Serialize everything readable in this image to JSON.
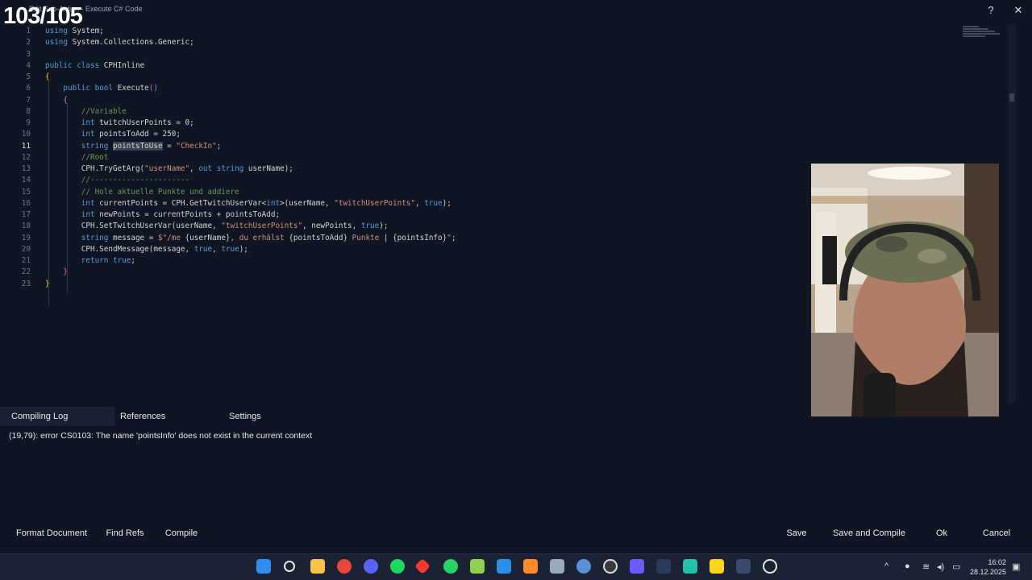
{
  "window": {
    "title": "Edit Sub-Action - Execute C# Code",
    "counter_overlay": "103/105",
    "help_label": "?",
    "close_label": "✕"
  },
  "editor": {
    "current_line": 11,
    "lines": [
      {
        "n": "1",
        "html": "<span class=\"kw\">using</span> System;"
      },
      {
        "n": "2",
        "html": "<span class=\"kw\">using</span> System.Collections.Generic;"
      },
      {
        "n": "3",
        "html": ""
      },
      {
        "n": "4",
        "html": "<span class=\"kw\">public</span> <span class=\"kw\">class</span> CPHInline"
      },
      {
        "n": "5",
        "html": "<span class=\"br1\">{</span>"
      },
      {
        "n": "6",
        "html": "    <span class=\"kw\">public</span> <span class=\"kw\">bool</span> Execute<span class=\"br2\">()</span>"
      },
      {
        "n": "7",
        "html": "    <span class=\"br2\">{</span>"
      },
      {
        "n": "8",
        "html": "        <span class=\"cm\">//Variable</span>"
      },
      {
        "n": "9",
        "html": "        <span class=\"kw\">int</span> twitchUserPoints = 0;"
      },
      {
        "n": "10",
        "html": "        <span class=\"kw\">int</span> pointsToAdd = 250;"
      },
      {
        "n": "11",
        "html": "        <span class=\"kw\">string</span> <span class=\"sel\">pointsToUse</span> = <span class=\"str\">\"CheckIn\"</span>;"
      },
      {
        "n": "12",
        "html": "        <span class=\"cm\">//Root</span>"
      },
      {
        "n": "13",
        "html": "        CPH.TryGetArg(<span class=\"str\">\"userName\"</span>, <span class=\"kw\">out</span> <span class=\"kw\">string</span> userName);"
      },
      {
        "n": "14",
        "html": "        <span class=\"cm\">//----------------------</span>"
      },
      {
        "n": "15",
        "html": "        <span class=\"cm\">// Hole aktuelle Punkte und addiere</span>"
      },
      {
        "n": "16",
        "html": "        <span class=\"kw\">int</span> currentPoints = CPH.GetTwitchUserVar&lt;<span class=\"kw\">int</span>&gt;(userName, <span class=\"str\">\"twitchUserPoints\"</span>, <span class=\"kw\">true</span>);"
      },
      {
        "n": "17",
        "html": "        <span class=\"kw\">int</span> newPoints = currentPoints + pointsToAdd;"
      },
      {
        "n": "18",
        "html": "        CPH.SetTwitchUserVar(userName, <span class=\"str\">\"twitchUserPoints\"</span>, newPoints, <span class=\"kw\">true</span>);"
      },
      {
        "n": "19",
        "html": "        <span class=\"kw\">string</span> message = <span class=\"str\">$\"/me </span>{userName}<span class=\"str\">, du erhälst </span>{pointsToAdd}<span class=\"str\"> Punkte </span>| {pointsInfo}<span class=\"str\">\"</span>;"
      },
      {
        "n": "20",
        "html": "        CPH.SendMessage(message, <span class=\"kw\">true</span>, <span class=\"kw\">true</span>);"
      },
      {
        "n": "21",
        "html": "        <span class=\"kw\">return</span> <span class=\"kw\">true</span>;"
      },
      {
        "n": "22",
        "html": "    <span class=\"br2\">}</span>"
      },
      {
        "n": "23",
        "html": "<span class=\"br1\">}</span>"
      }
    ]
  },
  "panel": {
    "tabs": [
      "Compiling Log",
      "References",
      "Settings"
    ],
    "active_tab": "Compiling Log",
    "log": "(19,79): error CS0103: The name 'pointsInfo' does not exist in the current context"
  },
  "buttons": {
    "format_document": "Format Document",
    "find_refs": "Find Refs",
    "compile": "Compile",
    "save": "Save",
    "save_and_compile": "Save and Compile",
    "ok": "Ok",
    "cancel": "Cancel"
  },
  "taskbar": {
    "time": "16:02",
    "date": "28.12.2025",
    "apps": [
      "windows-start-icon",
      "search-icon",
      "file-explorer-icon",
      "chrome-icon",
      "discord-icon",
      "spotify-icon",
      "git-icon",
      "whatsapp-icon",
      "vscode-icon",
      "affinity-icon",
      "steam-icon",
      "obs-icon",
      "obs-record-icon",
      "streamer-bot-icon",
      "audio-app-icon",
      "app-icon",
      "sticky-notes-icon",
      "game-bar-icon",
      "chatgpt-icon"
    ],
    "accent": "#0078d4"
  }
}
